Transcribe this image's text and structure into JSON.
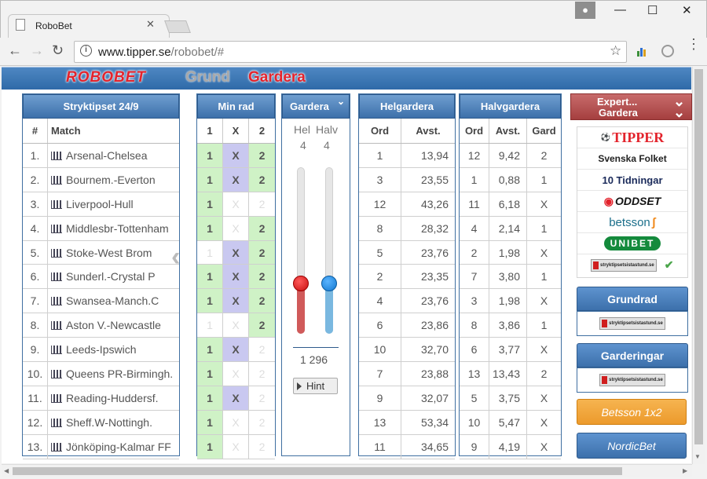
{
  "browser": {
    "tab_title": "RoboBet",
    "tab_close": "✕",
    "url_host": "www.tipper.se",
    "url_path": "/robobet/#",
    "back": "←",
    "forward": "→",
    "reload": "↻",
    "star": "☆",
    "info": "i",
    "minimize": "—",
    "maximize": "☐",
    "close": "✕",
    "menu": "⋮"
  },
  "site": {
    "logo": "ROBOBET",
    "nav": [
      "Grund",
      "Gardera"
    ]
  },
  "stryktips": {
    "title": "Stryktipset 24/9",
    "col_num": "#",
    "col_match": "Match",
    "matches": [
      {
        "num": "1.",
        "name": "Arsenal-Chelsea"
      },
      {
        "num": "2.",
        "name": "Bournem.-Everton"
      },
      {
        "num": "3.",
        "name": "Liverpool-Hull"
      },
      {
        "num": "4.",
        "name": "Middlesbr-Tottenham"
      },
      {
        "num": "5.",
        "name": "Stoke-West Brom"
      },
      {
        "num": "6.",
        "name": "Sunderl.-Crystal P"
      },
      {
        "num": "7.",
        "name": "Swansea-Manch.C"
      },
      {
        "num": "8.",
        "name": "Aston V.-Newcastle"
      },
      {
        "num": "9.",
        "name": "Leeds-Ipswich"
      },
      {
        "num": "10.",
        "name": "Queens PR-Birmingh."
      },
      {
        "num": "11.",
        "name": "Reading-Huddersf."
      },
      {
        "num": "12.",
        "name": "Sheff.W-Nottingh."
      },
      {
        "num": "13.",
        "name": "Jönköping-Kalmar FF"
      }
    ]
  },
  "minrad": {
    "title": "Min rad",
    "cols": [
      "1",
      "X",
      "2"
    ],
    "rows": [
      [
        true,
        true,
        true
      ],
      [
        true,
        true,
        true
      ],
      [
        true,
        false,
        false
      ],
      [
        true,
        false,
        true
      ],
      [
        false,
        true,
        true
      ],
      [
        true,
        true,
        true
      ],
      [
        true,
        true,
        true
      ],
      [
        false,
        false,
        true
      ],
      [
        true,
        true,
        false
      ],
      [
        true,
        false,
        false
      ],
      [
        true,
        true,
        false
      ],
      [
        true,
        false,
        false
      ],
      [
        true,
        false,
        false
      ]
    ]
  },
  "gardera": {
    "title": "Gardera",
    "hel_label": "Hel",
    "halv_label": "Halv",
    "hel_value": "4",
    "halv_value": "4",
    "hel_level": 0.3,
    "halv_level": 0.3,
    "rows_count": "1 296",
    "hint": "Hint"
  },
  "helgardera": {
    "title": "Helgardera",
    "cols": [
      "Ord",
      "Avst."
    ],
    "rows": [
      [
        "1",
        "13,94"
      ],
      [
        "3",
        "23,55"
      ],
      [
        "12",
        "43,26"
      ],
      [
        "8",
        "28,32"
      ],
      [
        "5",
        "23,76"
      ],
      [
        "2",
        "23,35"
      ],
      [
        "4",
        "23,76"
      ],
      [
        "6",
        "23,86"
      ],
      [
        "10",
        "32,70"
      ],
      [
        "7",
        "23,88"
      ],
      [
        "9",
        "32,07"
      ],
      [
        "13",
        "53,34"
      ],
      [
        "11",
        "34,65"
      ]
    ]
  },
  "halvgardera": {
    "title": "Halvgardera",
    "cols": [
      "Ord",
      "Avst.",
      "Gard"
    ],
    "rows": [
      [
        "12",
        "9,42",
        "2"
      ],
      [
        "1",
        "0,88",
        "1"
      ],
      [
        "11",
        "6,18",
        "X"
      ],
      [
        "4",
        "2,14",
        "1"
      ],
      [
        "2",
        "1,98",
        "X"
      ],
      [
        "7",
        "3,80",
        "1"
      ],
      [
        "3",
        "1,98",
        "X"
      ],
      [
        "8",
        "3,86",
        "1"
      ],
      [
        "6",
        "3,77",
        "X"
      ],
      [
        "13",
        "13,43",
        "2"
      ],
      [
        "5",
        "3,75",
        "X"
      ],
      [
        "10",
        "5,47",
        "X"
      ],
      [
        "9",
        "4,19",
        "X"
      ]
    ]
  },
  "expert": {
    "title_line1": "Expert...",
    "title_line2": "Gardera",
    "tipsters": [
      "TIPPER",
      "Svenska Folket",
      "10 Tidningar",
      "ODDSET",
      "betsson",
      "UNIBET",
      "stryktipsetsistastund.se"
    ],
    "tipster_check": "✔",
    "grundrad": "Grundrad",
    "grundrad_source": "stryktipsetsistastund.se",
    "garderingar": "Garderingar",
    "garderingar_source": "stryktipsetsistastund.se",
    "betsson_btn": "Betsson 1x2",
    "nordicbet_btn": "NordicBet"
  },
  "colors": {
    "header_blue": "#3d70aa",
    "pick_green": "#cff2c6",
    "pick_purple": "#c9c8f0",
    "brand_red": "#e3232c",
    "expert_red": "#b54a4a",
    "betsson_orange": "#f0a63b"
  }
}
